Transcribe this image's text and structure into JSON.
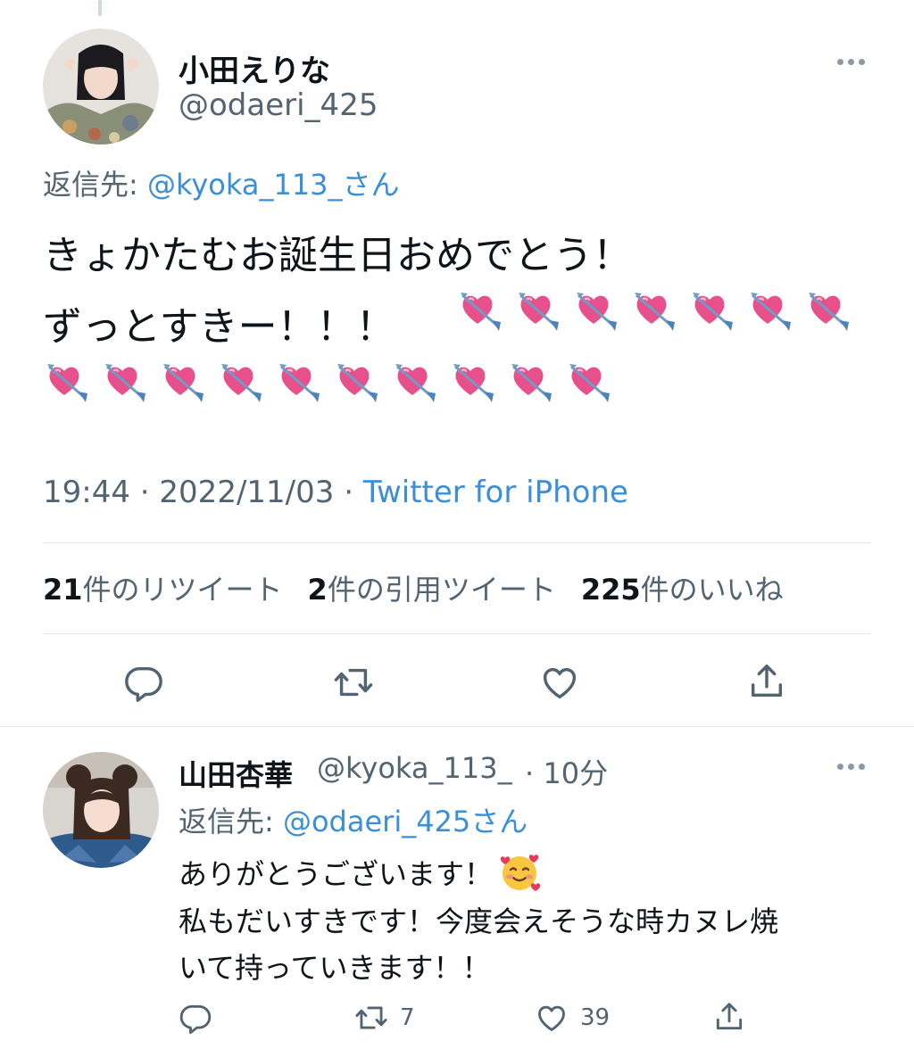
{
  "main_tweet": {
    "name": "小田えりな",
    "handle": "@odaeri_425",
    "reply_prefix": "返信先: ",
    "reply_handle": "@kyoka_113_さん",
    "text_line1": "きょかたむお誕生日おめでとう！",
    "text_line2": "ずっとすきー！！！",
    "heart_arrow_count_line2": 7,
    "heart_arrow_count_line3": 10,
    "time": "19:44",
    "date": "2022/11/03",
    "source": "Twitter for iPhone",
    "separator": " · ",
    "stats": {
      "retweets_count": "21",
      "retweets_label": "件のリツイート",
      "quotes_count": "2",
      "quotes_label": "件の引用ツイート",
      "likes_count": "225",
      "likes_label": "件のいいね"
    }
  },
  "reply_tweet": {
    "name": "山田杏華",
    "handle": "@kyoka_113_",
    "time_ago": "· 10分",
    "reply_prefix": "返信先: ",
    "reply_handle": "@odaeri_425さん",
    "text_line1": "ありがとうございます！",
    "text_line2": "私もだいすきです！今度会えそうな時カヌレ焼",
    "text_line3": "いて持っていきます！！",
    "retweet_count": "7",
    "like_count": "39"
  },
  "icons": {
    "more": "more-icon",
    "reply": "reply-icon",
    "retweet": "retweet-icon",
    "like": "heart-icon",
    "share": "share-icon",
    "emoji_heart_arrow": "heart-with-arrow-emoji",
    "emoji_smiling_hearts": "smiling-face-with-hearts-emoji"
  },
  "colors": {
    "link": "#3b8fd6",
    "secondary_text": "#536471",
    "primary_text": "#0f1419"
  }
}
